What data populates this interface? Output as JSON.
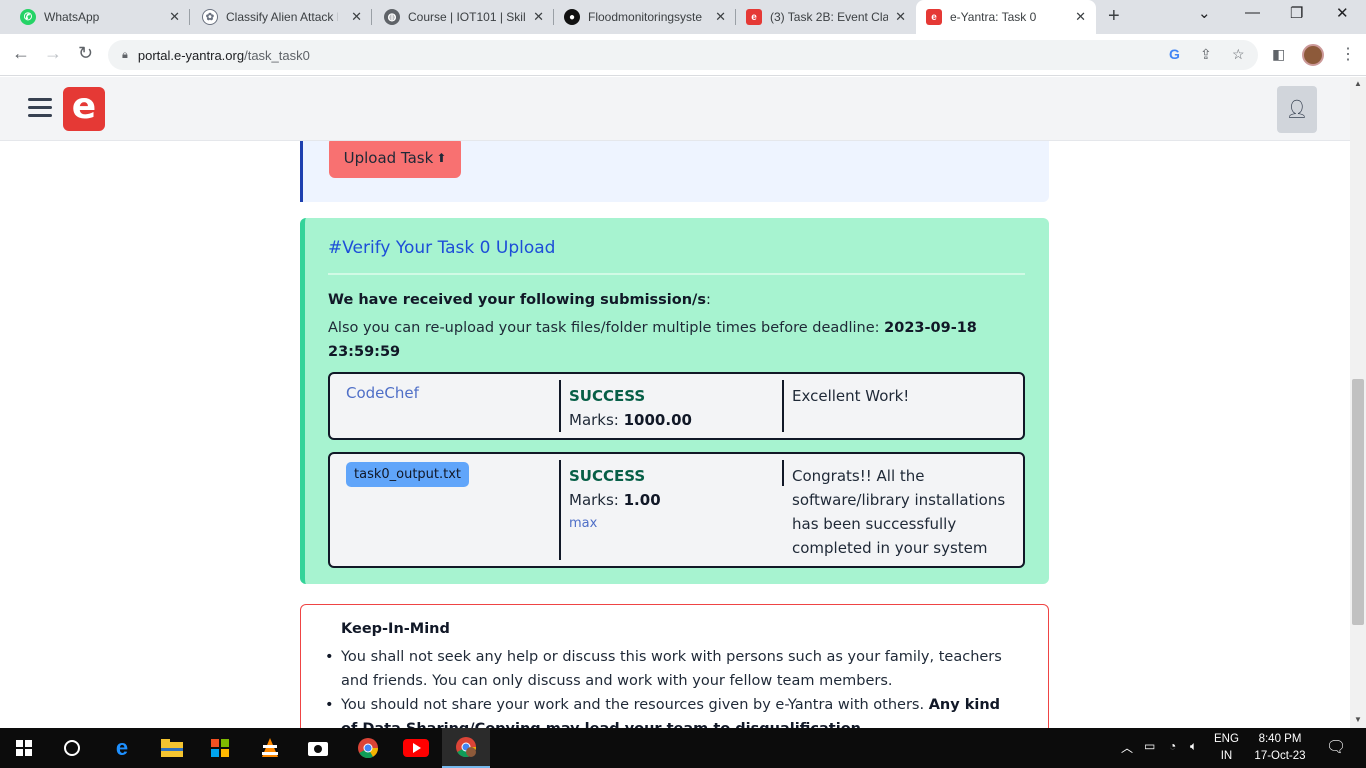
{
  "browser": {
    "tabs": [
      {
        "title": "WhatsApp",
        "icon": "whatsapp-icon",
        "color": "#25d366"
      },
      {
        "title": "Classify Alien Attack I",
        "icon": "chatgpt-icon",
        "color": "#6b7280"
      },
      {
        "title": "Course | IOT101 | Skill",
        "icon": "globe-icon",
        "color": "#5f6368"
      },
      {
        "title": "Floodmonitoringsyste",
        "icon": "github-icon",
        "color": "#111111"
      },
      {
        "title": "(3) Task 2B: Event Cla",
        "icon": "eyantra-icon",
        "color": "#e53935"
      },
      {
        "title": "e-Yantra: Task 0",
        "icon": "eyantra-icon",
        "color": "#e53935",
        "active": true
      }
    ],
    "url_host": "portal.e-yantra.org",
    "url_path": "/task_task0"
  },
  "site": {
    "logo_letter": "e",
    "upload_button": "Upload Task"
  },
  "verify": {
    "title": "#Verify Your Task 0 Upload",
    "received_bold": "We have received your following submission/s",
    "received_tail": ":",
    "reupload_text": "Also you can re-upload your task files/folder multiple times before deadline: ",
    "deadline": "2023-09-18 23:59:59",
    "submissions": [
      {
        "name": "CodeChef",
        "status": "SUCCESS",
        "marks_label": "Marks: ",
        "marks": "1000.00",
        "remark": "Excellent Work!"
      },
      {
        "file": "task0_output.txt",
        "status": "SUCCESS",
        "marks_label": "Marks: ",
        "marks": "1.00",
        "max_link": "max",
        "remark": "Congrats!! All the software/library installations has been successfully completed in your system"
      }
    ]
  },
  "keep_in_mind": {
    "title": "Keep-In-Mind",
    "items": [
      {
        "text": "You shall not seek any help or discuss this work with persons such as your family, teachers and friends. You can only discuss and work with your fellow team members."
      },
      {
        "text": "You should not share your work and the resources given by e-Yantra with others. ",
        "bold": "Any kind of Data Sharing/Copying may lead your team to disqualification."
      }
    ]
  },
  "taskbar": {
    "lang_1": "ENG",
    "lang_2": "IN",
    "time": "8:40 PM",
    "date": "17-Oct-23"
  }
}
